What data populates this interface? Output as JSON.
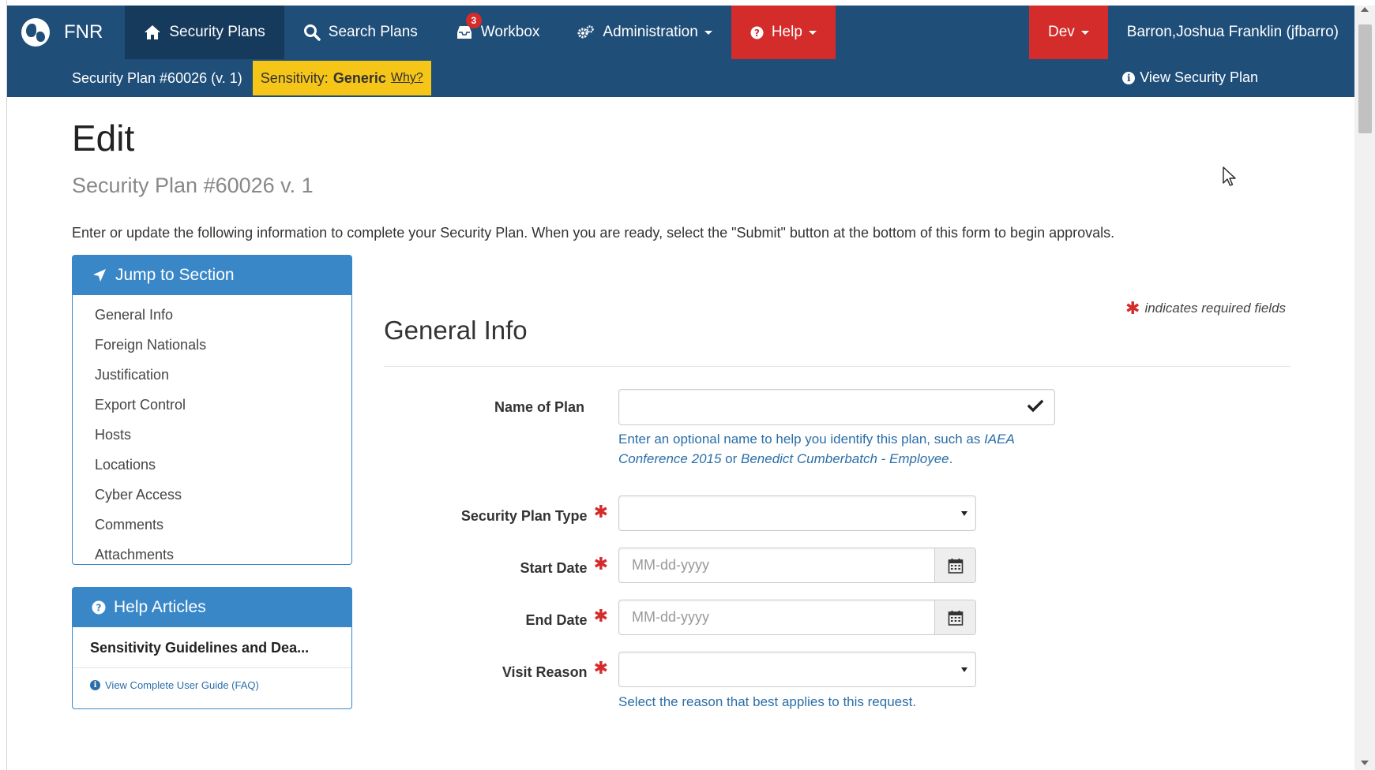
{
  "brand": {
    "name": "FNR"
  },
  "nav": {
    "security_plans": "Security Plans",
    "search_plans": "Search Plans",
    "workbox": "Workbox",
    "workbox_badge": "3",
    "administration": "Administration",
    "help": "Help",
    "dev": "Dev",
    "user": "Barron,Joshua Franklin (jfbarro)"
  },
  "subbar": {
    "plan_id": "Security Plan #60026 (v. 1)",
    "sensitivity_label": "Sensitivity:",
    "sensitivity_value": "Generic",
    "why": "Why?",
    "view_plan": "View Security Plan"
  },
  "page": {
    "title": "Edit",
    "subtitle": "Security Plan #60026 v. 1",
    "intro": "Enter or update the following information to complete your Security Plan. When you are ready, select the \"Submit\" button at the bottom of this form to begin approvals."
  },
  "jump": {
    "title": "Jump to Section",
    "items": [
      "General Info",
      "Foreign Nationals",
      "Justification",
      "Export Control",
      "Hosts",
      "Locations",
      "Cyber Access",
      "Comments",
      "Attachments"
    ]
  },
  "help_panel": {
    "title": "Help Articles",
    "article": "Sensitivity Guidelines and Dea...",
    "faq": "View Complete User Guide (FAQ)"
  },
  "form": {
    "required_note": "indicates required fields",
    "section_title": "General Info",
    "name_label": "Name of Plan",
    "name_value": "",
    "name_hint_prefix": "Enter an optional name to help you identify this plan, such as ",
    "name_hint_ex1": "IAEA Conference 2015",
    "name_hint_or": " or ",
    "name_hint_ex2": "Benedict Cumberbatch - Employee",
    "name_hint_end": ".",
    "type_label": "Security Plan Type",
    "type_value": "",
    "start_label": "Start Date",
    "start_placeholder": "MM-dd-yyyy",
    "end_label": "End Date",
    "end_placeholder": "MM-dd-yyyy",
    "reason_label": "Visit Reason",
    "reason_value": "",
    "reason_hint": "Select the reason that best applies to this request."
  },
  "colors": {
    "navbar": "#1f4e79",
    "active_nav": "#163a5c",
    "help_red": "#d42b2b",
    "sensitivity_yellow": "#f5c518",
    "panel_blue": "#3a87c8",
    "hint_blue": "#2a6ea8"
  }
}
